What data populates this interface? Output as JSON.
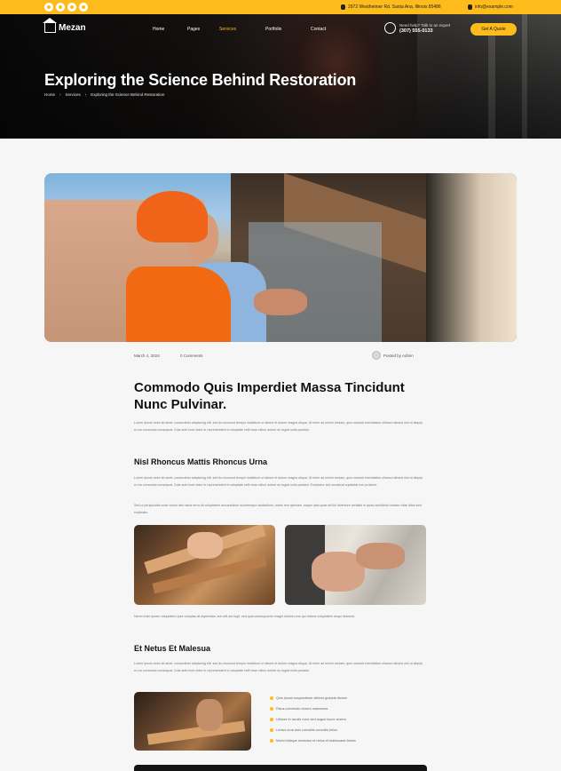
{
  "topbar": {
    "social_icons": [
      "facebook-icon",
      "twitter-icon",
      "instagram-icon",
      "linkedin-icon"
    ],
    "location": "2972 Westheimer Rd. Santa Ana, Illinois 85486",
    "email": "info@example.com"
  },
  "header": {
    "logo": "Mezan",
    "nav": [
      "Home",
      "Pages",
      "Services",
      "Portfolio",
      "Contact"
    ],
    "phone_label": "Need help? Talk to an expert",
    "phone": "(307) 555-0133",
    "cta": "Get A Quote"
  },
  "hero": {
    "title": "Exploring the Science Behind Restoration",
    "breadcrumbs": [
      "Home",
      "Services",
      "Exploring the Science Behind Restoration"
    ]
  },
  "meta": {
    "date": "March 4, 2024",
    "comments": "0 Comments",
    "author": "Posted by Admin"
  },
  "article": {
    "title": "Commodo Quis Imperdiet Massa Tincidunt Nunc Pulvinar.",
    "p1": "Lorem ipsum dolor sit amet, consectetur adipiscing elit, sed do eiusmod tempor incididunt ut labore et dolore magna aliqua. Ut enim ad minim veniam, quis nostrud exercitation ullamco laboris nisi ut aliquip ex ea commodo consequat. Duis aute irure dolor in reprehenderit in voluptate velit esse cillum dolore eu fugiat nulla pariatur.",
    "h2a": "Nisl Rhoncus Mattis Rhoncus Urna",
    "p2": "Lorem ipsum dolor sit amet, consectetur adipiscing elit, sed do eiusmod tempor incididunt ut labore et dolore magna aliqua. Ut enim ad minim veniam, quis nostrud exercitation ullamco laboris nisi ut aliquip ex ea commodo consequat. Duis aute irure dolor in reprehenderit in voluptate velit esse cillum dolore eu fugiat nulla pariatur. Excepteur sint occaecat cupidatat non proident.",
    "p3": "Sed ut perspiciatis unde omnis iste natus error sit voluptatem accusantium doloremque laudantium, totam rem aperiam, eaque ipsa quae ab illo inventore veritatis et quasi architecto beatae vitae dicta sunt explicabo.",
    "p4": "Nemo enim ipsam voluptatem quia voluptas sit aspernatur aut odit aut fugit, sed quia consequuntur magni dolores eos qui ratione voluptatem sequi nesciunt.",
    "h2b": "Et Netus Et Malesua",
    "p5": "Lorem ipsum dolor sit amet, consectetur adipiscing elit, sed do eiusmod tempor incididunt ut labore et dolore magna aliqua. Ut enim ad minim veniam, quis nostrud exercitation ullamco laboris nisi ut aliquip ex ea commodo consequat. Duis aute irure dolor in reprehenderit in voluptate velit esse cillum dolore eu fugiat nulla pariatur.",
    "list": [
      "Quis ipsum suspendisse ultrices gravida dictum",
      "Risus commodo viverra maecenas",
      "Ultrices in iaculis nunc sed augue lacus viverra",
      "Lectus urna duis convallis convallis tellus",
      "Morbi tristique senectus et netus et malesuada fames"
    ]
  },
  "colors": {
    "accent": "#fdbb1c",
    "dark": "#111111"
  }
}
